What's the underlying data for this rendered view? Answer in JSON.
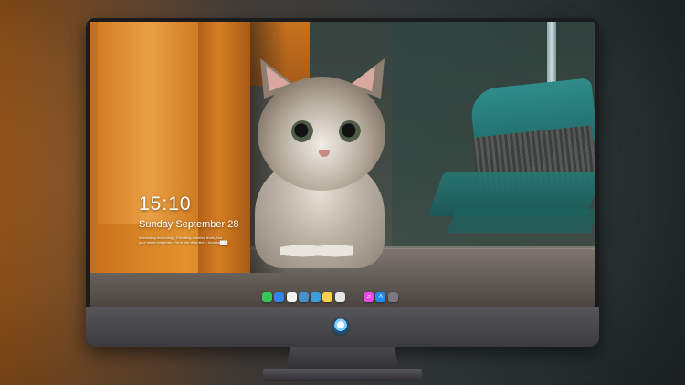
{
  "lock_screen": {
    "time": "15:10",
    "date": "Sunday September 28",
    "caption_line1": "Interesting technology, Elevating creative limits, Not",
    "caption_line2": "your usual computer. For a one view like... Access███"
  },
  "dock": {
    "left_group": [
      {
        "name": "messages-icon",
        "color": "#35c759",
        "glyph": ""
      },
      {
        "name": "finder-icon",
        "color": "#2f86e8",
        "glyph": ""
      },
      {
        "name": "clock-icon",
        "color": "#f2f2f2",
        "glyph": ""
      },
      {
        "name": "preview-icon",
        "color": "#4a8fc9",
        "glyph": ""
      },
      {
        "name": "imovie-icon",
        "color": "#3b9edb",
        "glyph": ""
      },
      {
        "name": "notes-icon",
        "color": "#f7d14a",
        "glyph": ""
      },
      {
        "name": "photos-icon",
        "color": "#e7e7e7",
        "glyph": ""
      }
    ],
    "right_group": [
      {
        "name": "music-icon",
        "color": "#e94ae0",
        "glyph": "♫"
      },
      {
        "name": "app-store-icon",
        "color": "#1f8cf0",
        "glyph": "A"
      },
      {
        "name": "camera-icon",
        "color": "#7a7a7e",
        "glyph": ""
      }
    ]
  },
  "colors": {
    "monitor_bezel": "#1b1b1d",
    "monitor_chin": "#4a494e",
    "door_orange": "#d98628",
    "broom_teal": "#2f8c8a"
  }
}
